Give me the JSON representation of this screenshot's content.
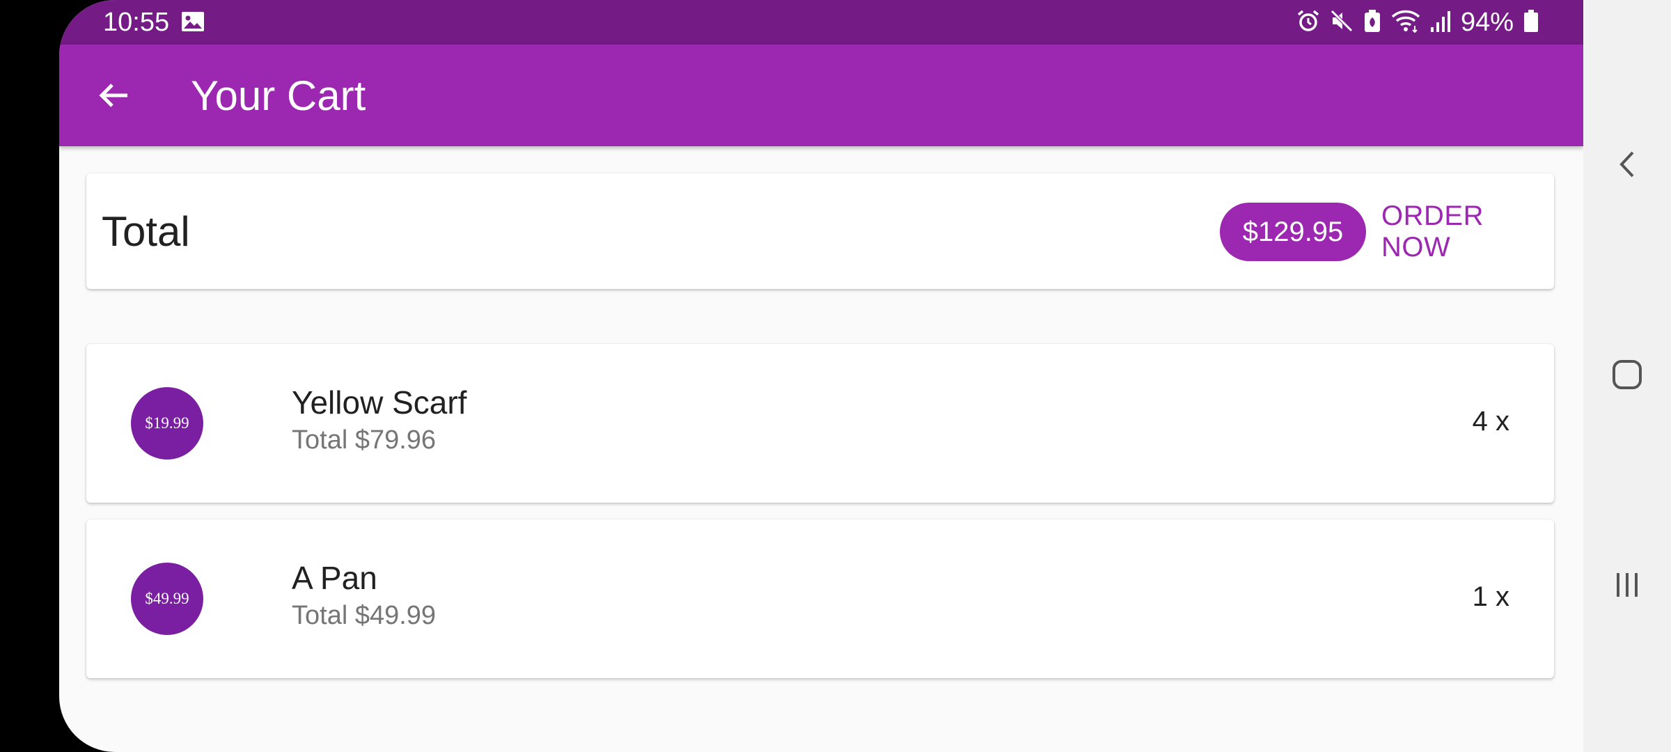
{
  "status_bar": {
    "time": "10:55",
    "battery_percent": "94%",
    "icons": [
      "image-icon",
      "alarm-icon",
      "mute-icon",
      "battery-saver-icon",
      "wifi-icon",
      "signal-icon",
      "battery-icon"
    ],
    "background": "#741b86"
  },
  "app_bar": {
    "title": "Your Cart",
    "background": "#9c27b0"
  },
  "summary": {
    "label": "Total",
    "amount": "$129.95",
    "order_button": "ORDER NOW",
    "accent": "#9c27b0"
  },
  "items": [
    {
      "price": "$19.99",
      "title": "Yellow Scarf",
      "subtitle": "Total $79.96",
      "quantity": "4 x"
    },
    {
      "price": "$49.99",
      "title": "A Pan",
      "subtitle": "Total $49.99",
      "quantity": "1 x"
    }
  ],
  "nav_bar": {
    "buttons": [
      "back-icon",
      "home-icon",
      "recents-icon"
    ]
  }
}
